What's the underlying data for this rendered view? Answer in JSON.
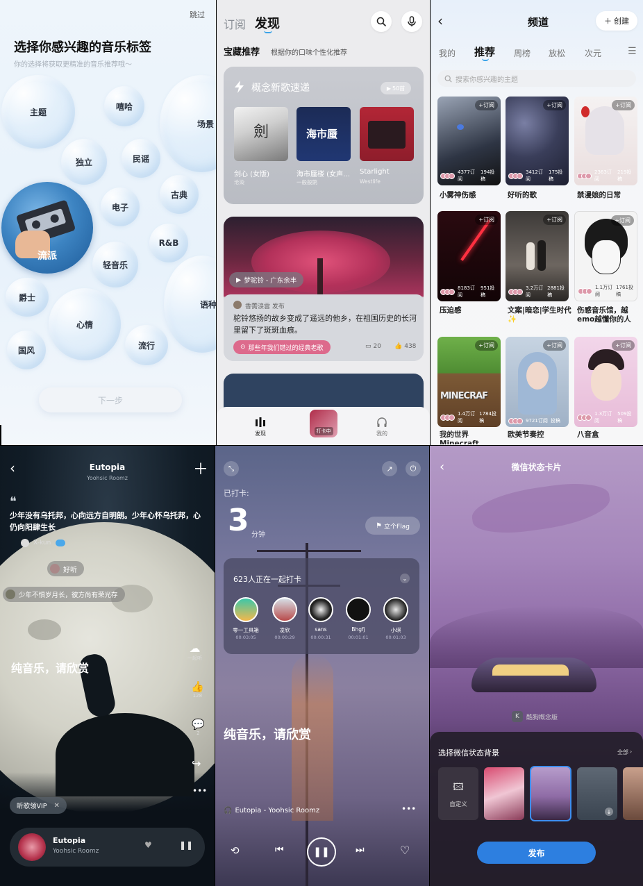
{
  "p1": {
    "skip": "跳过",
    "title": "选择你感兴趣的音乐标签",
    "subtitle": "你的选择将获取更精准的音乐推荐哦～",
    "tags": [
      "主题",
      "嘻哈",
      "场景",
      "独立",
      "民谣",
      "电子",
      "古典",
      "流派",
      "R&B",
      "轻音乐",
      "爵士",
      "心情",
      "语种",
      "国风",
      "流行"
    ],
    "next": "下一步"
  },
  "p2": {
    "tabs": [
      "订阅",
      "发现"
    ],
    "section_title": "宝藏推荐",
    "section_sub": "根据你的口味个性化推荐",
    "concept": {
      "title": "概念新歌速递",
      "badge": "50首",
      "items": [
        {
          "name": "剑心 (女版)",
          "artist": "沧染"
        },
        {
          "name": "海市蜃楼 (女声…",
          "artist": "一般般鹅"
        },
        {
          "name": "Starlight",
          "artist": "Westlife"
        }
      ]
    },
    "post": {
      "song_tag": "梦驼铃 - 广东余丰",
      "author": "香薷涙雲 发布",
      "text": "驼铃悠扬的故乡变成了遥远的他乡，在祖国历史的长河里留下了斑斑血痕。",
      "topic": "那些年我们错过的经典老歌",
      "comments": "20",
      "likes": "438"
    },
    "nav": [
      "发现",
      "打卡中",
      "我的"
    ]
  },
  "p3": {
    "title": "频道",
    "create": "创建",
    "tabs": [
      "我的",
      "推荐",
      "周榜",
      "放松",
      "次元"
    ],
    "search_placeholder": "搜索你感兴趣的主题",
    "subscribe": "订阅",
    "cards": [
      {
        "title": "小雾神伤感",
        "stats": "4377订阅",
        "posts": "194投稿"
      },
      {
        "title": "好听的歌",
        "stats": "3412订阅",
        "posts": "175投稿"
      },
      {
        "title": "禁漫娘的日常",
        "stats": "2363订阅",
        "posts": "219投稿"
      },
      {
        "title": "压迫感",
        "stats": "8183订阅",
        "posts": "951投稿"
      },
      {
        "title": "文案|暗恋|学生时代✨",
        "stats": "3.2万订阅",
        "posts": "2881投稿"
      },
      {
        "title": "伤感音乐馆，越emo越懂你的人",
        "stats": "1.1万订阅",
        "posts": "1761投稿"
      },
      {
        "title": "我的世界Minecraft",
        "stats": "1.4万订阅",
        "posts": "1784投稿"
      },
      {
        "title": "欧美节奏控",
        "stats": "9721订阅",
        "posts": "投稿"
      },
      {
        "title": "八音盒",
        "stats": "1.3万订阅",
        "posts": "509投稿"
      }
    ]
  },
  "p4": {
    "title": "Eutopia",
    "artist": "Yoohsic Roomz",
    "quote": "少年没有乌托邦，心向远方自明朗。少年心怀乌托邦，心仍向阳肆生长",
    "user": "X-kun",
    "comment1": "好听",
    "comment2": "少年不惧岁月长，彼方尚有荣光存",
    "pure": "纯音乐，请欣赏",
    "side": [
      "一起听",
      "128",
      "2"
    ],
    "vip": "听歌领VIP",
    "mini_title": "Eutopia",
    "mini_artist": "Yoohsic Roomz"
  },
  "p5": {
    "label": "已打卡:",
    "minutes": "3",
    "unit": "分钟",
    "flag": "立个Flag",
    "count_text": "623人正在一起打卡",
    "users": [
      {
        "name": "零一工具箱",
        "time": "00:03:05"
      },
      {
        "name": "凌欣",
        "time": "00:00:29"
      },
      {
        "name": "sans",
        "time": "00:00:31"
      },
      {
        "name": "Bhgfj",
        "time": "00:01:01"
      },
      {
        "name": "小琪",
        "time": "00:01:03"
      }
    ],
    "pure": "纯音乐，请欣赏",
    "now": "Eutopia - Yoohsic Roomz"
  },
  "p6": {
    "title": "微信状态卡片",
    "brand": "酷狗概念版",
    "choose": "选择微信状态背景",
    "all": "全部",
    "custom": "自定义",
    "publish": "发布"
  }
}
